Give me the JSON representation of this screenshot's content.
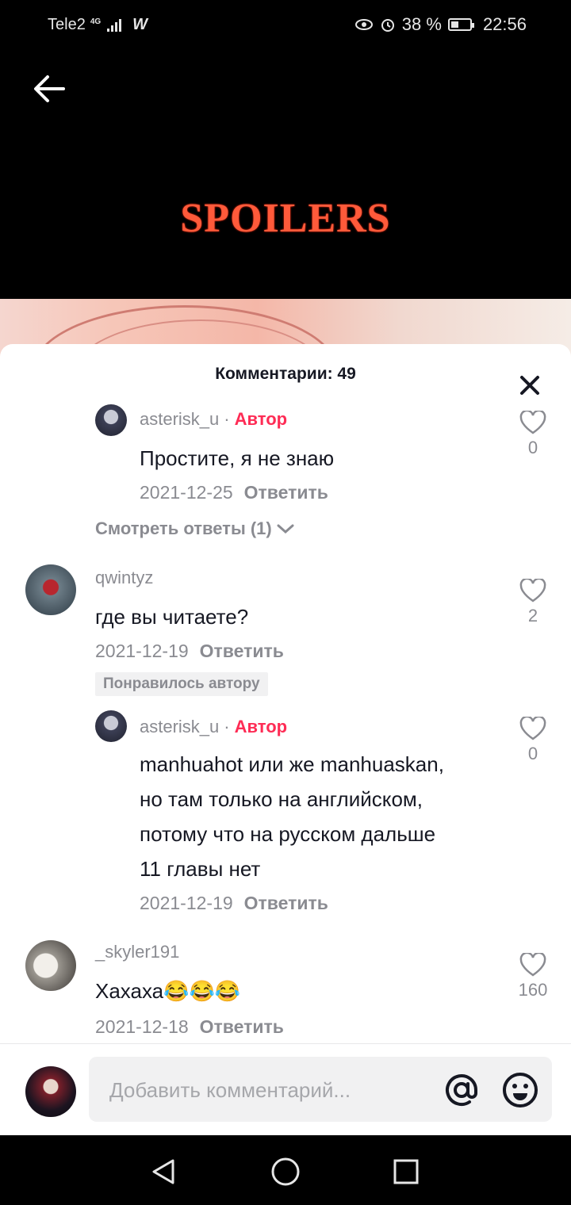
{
  "status_bar": {
    "carrier": "Tele2",
    "network": "4G",
    "battery": "38 %",
    "battery_level": 0.38,
    "time": "22:56"
  },
  "video": {
    "caption": "SPOILERS"
  },
  "comments_sheet": {
    "title": "Комментарии: 49",
    "comments": [
      {
        "username": "asterisk_u",
        "author_badge": "Автор",
        "text": "Простите, я не знаю",
        "date": "2021-12-25",
        "reply_label": "Ответить",
        "likes": "0",
        "is_reply": true
      },
      {
        "username": "qwintyz",
        "text": "где вы читаете?",
        "date": "2021-12-19",
        "reply_label": "Ответить",
        "likes": "2",
        "liked_by_author": "Понравилось автору"
      },
      {
        "username": "asterisk_u",
        "author_badge": "Автор",
        "text_lines": [
          "manhuahot или же manhuaskan,",
          "но там только на английском,",
          "потому что на русском дальше",
          "11 главы нет"
        ],
        "date": "2021-12-19",
        "reply_label": "Ответить",
        "likes": "0",
        "is_reply": true
      },
      {
        "username": "_skyler191",
        "text": "Хахаха😂😂😂",
        "date": "2021-12-18",
        "reply_label": "Ответить",
        "likes": "160"
      }
    ],
    "view_replies": "Смотреть ответы (1)"
  },
  "input": {
    "placeholder": "Добавить комментарий..."
  },
  "colors": {
    "accent": "#fe2c55",
    "secondary_text": "#8a8b91",
    "primary_text": "#161823",
    "spoiler_red": "#ff5a3a"
  },
  "icons": [
    "back-arrow-icon",
    "close-icon",
    "heart-icon",
    "chevron-down-icon",
    "at-icon",
    "emoji-icon",
    "nav-back-icon",
    "nav-home-icon",
    "nav-recents-icon",
    "eye-icon",
    "alarm-icon",
    "battery-icon",
    "signal-icon"
  ]
}
